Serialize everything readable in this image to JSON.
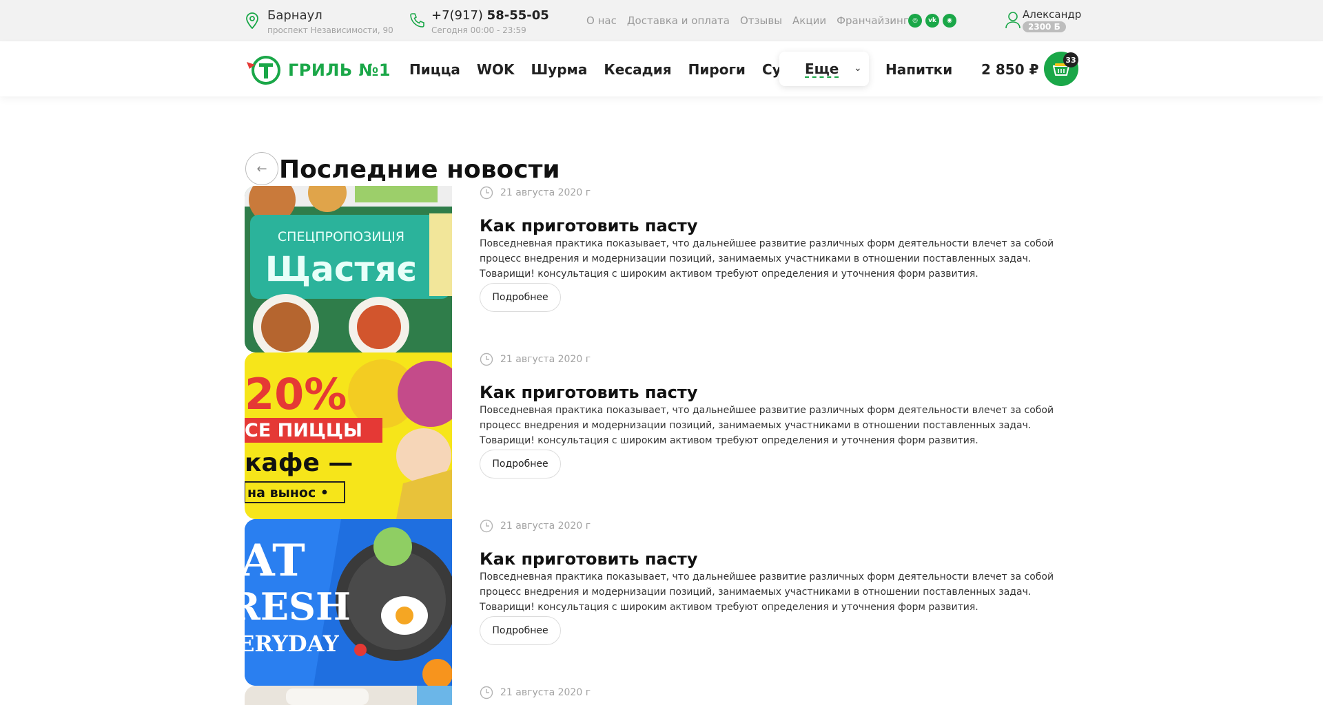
{
  "topbar": {
    "city": "Барнаул",
    "address": "проспект Независимости, 90",
    "phone_prefix": "+7(917)",
    "phone_number": "58-55-05",
    "hours": "Сегодня 00:00 - 23:59",
    "links": [
      "О нас",
      "Доставка и оплата",
      "Отзывы",
      "Акции",
      "Франчайзинг"
    ],
    "social": [
      {
        "name": "instagram-icon",
        "glyph": "◎"
      },
      {
        "name": "vk-icon",
        "glyph": "vk"
      },
      {
        "name": "tripadvisor-icon",
        "glyph": "◉"
      }
    ],
    "user_name": "Александр",
    "user_bonus": "2300 Б"
  },
  "navbar": {
    "logo_text": "ГРИЛЬ №1",
    "menu": [
      "Пицца",
      "WOK",
      "Шурма",
      "Кесадия",
      "Пироги",
      "Супы"
    ],
    "more_label": "Еще",
    "drinks": "Напитки",
    "cart_total": "2 850 ₽",
    "cart_count": "33"
  },
  "page": {
    "title": "Последние новости"
  },
  "news": [
    {
      "date": "21 августа 2020 г",
      "title": "Как приготовить пасту",
      "text": "Повседневная практика показывает, что дальнейшее развитие различных форм деятельности влечет за собой процесс внедрения и модернизации позиций, занимаемых участниками в отношении поставленных задач. Товарищи! консультация с широким активом требуют определения и уточнения форм развития.",
      "button": "Подробнее",
      "image_lines": [
        "СПЕЦПРОПОЗИЦІЯ",
        "Щастяє"
      ]
    },
    {
      "date": "21 августа 2020 г",
      "title": "Как приготовить пасту",
      "text": "Повседневная практика показывает, что дальнейшее развитие различных форм деятельности влечет за собой процесс внедрения и модернизации позиций, занимаемых участниками в отношении поставленных задач. Товарищи! консультация с широким активом требуют определения и уточнения форм развития.",
      "button": "Подробнее",
      "image_lines": [
        "20%",
        "СЕ ПИЦЦЫ",
        "кафе —",
        "на вынос •"
      ]
    },
    {
      "date": "21 августа 2020 г",
      "title": "Как приготовить пасту",
      "text": "Повседневная практика показывает, что дальнейшее развитие различных форм деятельности влечет за собой процесс внедрения и модернизации позиций, занимаемых участниками в отношении поставленных задач. Товарищи! консультация с широким активом требуют определения и уточнения форм развития.",
      "button": "Подробнее",
      "image_lines": [
        "AT",
        "RESH",
        "ERYDAY"
      ]
    },
    {
      "date": "21 августа 2020 г"
    }
  ],
  "colors": {
    "brand_green": "#1aa748",
    "topbar_bg": "#f2f2f2",
    "muted_text": "#a3a3a3"
  }
}
